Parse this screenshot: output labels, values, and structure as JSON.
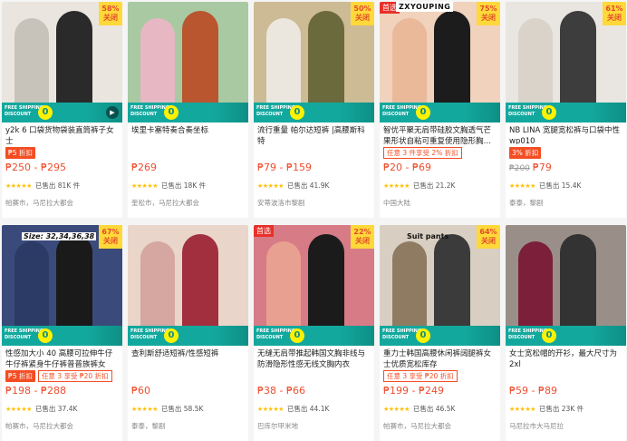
{
  "banner": {
    "free_line1": "FREE SHIPPING",
    "free_line2": "DISCOUNT",
    "zero": "0"
  },
  "products": [
    {
      "title": "y2k 6 口袋货物袋装直筒裤子女士",
      "discount": [
        "58%",
        "关闭"
      ],
      "offer": "₱5 折扣",
      "promo": "",
      "old_price": "",
      "price": "₱250 - ₱295",
      "stars": "★★★★★",
      "sold": "已售出 81K 件",
      "location": "帕赛市，马尼拉大都会",
      "has_video": true,
      "brand_tag": "",
      "mall_tag": "",
      "img_colors": [
        "#c8c3ba",
        "#2a2a2a",
        "#eae6df"
      ]
    },
    {
      "title": "埃里卡塞特奏合奏坐标",
      "discount": [],
      "offer": "",
      "promo": "",
      "old_price": "",
      "price": "₱269",
      "stars": "★★★★★",
      "sold": "已售出 18K 件",
      "location": "奎松市，马尼拉大都会",
      "has_video": false,
      "brand_tag": "",
      "mall_tag": "",
      "img_colors": [
        "#e7b7c3",
        "#b9552f",
        "#a8c9a2"
      ]
    },
    {
      "title": "流行重量 帕尔达短裤 |高腰斯科特",
      "discount": [
        "50%",
        "关闭"
      ],
      "offer": "",
      "promo": "",
      "old_price": "",
      "price": "₱79 - ₱159",
      "stars": "★★★★★",
      "sold": "已售出 41.9K",
      "location": "安蒂波洛市黎剧",
      "has_video": false,
      "brand_tag": "",
      "mall_tag": "",
      "img_colors": [
        "#ece7de",
        "#6a6a3c",
        "#cdbb95"
      ]
    },
    {
      "title": "智优平聚无肩带硅胶文胸透气芒果形状自粘可重复使用隐形胸…",
      "discount": [
        "75%",
        "关闭"
      ],
      "offer": "",
      "promo": "任意 3 件享受 2% 折扣",
      "old_price": "",
      "price": "₱20 - ₱69",
      "stars": "★★★★★",
      "sold": "已售出 21.2K",
      "location": "中国大陆",
      "has_video": false,
      "brand_tag": "ZXYOUPING",
      "mall_tag": "首选",
      "img_colors": [
        "#e9b99a",
        "#1c1c1c",
        "#f0d2bd"
      ]
    },
    {
      "title": "NB LINA 宽腿宽松裤与口袋中性 wp010",
      "discount": [
        "61%",
        "关闭"
      ],
      "offer": "3% 折扣",
      "promo": "",
      "old_price": "₱200",
      "price": "₱79",
      "stars": "★★★★★",
      "sold": "已售出 15.4K",
      "location": "泰泰，黎剧",
      "has_video": false,
      "brand_tag": "",
      "mall_tag": "",
      "img_colors": [
        "#d9d3c9",
        "#3d3d3d",
        "#e9e6e1"
      ]
    },
    {
      "title": "性感加大小 40 高腰可拉伸牛仔牛仔裤紧身牛仔裤普普族裤女士…",
      "discount": [
        "67%",
        "关闭"
      ],
      "offer": "₱5 折扣",
      "promo": "任意 3 享受 ₱20 折扣",
      "old_price": "",
      "price": "₱198 - ₱288",
      "stars": "★★★★★",
      "sold": "已售出 37.4K",
      "location": "帕赛市，马尼拉大都会",
      "has_video": false,
      "brand_tag": "",
      "mall_tag": "",
      "overlay": "Size: 32,34,36,38",
      "img_colors": [
        "#2c3a66",
        "#1a1a1a",
        "#3a4a7a"
      ]
    },
    {
      "title": "查利斯舒适短裤/性感短裤",
      "discount": [],
      "offer": "",
      "promo": "",
      "old_price": "",
      "price": "₱60",
      "stars": "★★★★★",
      "sold": "已售出 58.5K",
      "location": "泰泰，黎剧",
      "has_video": false,
      "brand_tag": "",
      "mall_tag": "",
      "img_colors": [
        "#d6a6a0",
        "#a12f3e",
        "#e9d5c9"
      ]
    },
    {
      "title": "无缝无肩带推起韩国文胸非线与防滑隐形性感无线文胸内衣",
      "discount": [
        "22%",
        "关闭"
      ],
      "offer": "",
      "promo": "",
      "old_price": "",
      "price": "₱38 - ₱66",
      "stars": "★★★★★",
      "sold": "已售出 44.1K",
      "location": "巴库尔甲米地",
      "has_video": false,
      "brand_tag": "",
      "mall_tag": "首选",
      "img_colors": [
        "#e8a091",
        "#1b1b1b",
        "#d77b86"
      ]
    },
    {
      "title": "重力士韩国高腰休闲裤阔腿裤女士优质宽松库存",
      "discount": [
        "64%",
        "关闭"
      ],
      "offer": "",
      "promo": "任意 3 享受 ₱20 折扣",
      "old_price": "",
      "price": "₱199 - ₱249",
      "stars": "★★★★★",
      "sold": "已售出 46.5K",
      "location": "帕赛市，马尼拉大都会",
      "has_video": false,
      "brand_tag": "",
      "mall_tag": "",
      "overlay_dark": "Suit pants",
      "img_colors": [
        "#8e7b62",
        "#3b3b3b",
        "#d8cfc2"
      ]
    },
    {
      "title": "女士宽松帽的开衫，最大尺寸为 2xl",
      "discount": [],
      "offer": "",
      "promo": "",
      "old_price": "",
      "price": "₱59 - ₱89",
      "stars": "★★★★★",
      "sold": "已售出 23K 件",
      "location": "马尼拉市大马尼拉",
      "has_video": false,
      "brand_tag": "",
      "mall_tag": "",
      "img_colors": [
        "#7b1f3a",
        "#333333",
        "#9a8f88"
      ]
    }
  ]
}
